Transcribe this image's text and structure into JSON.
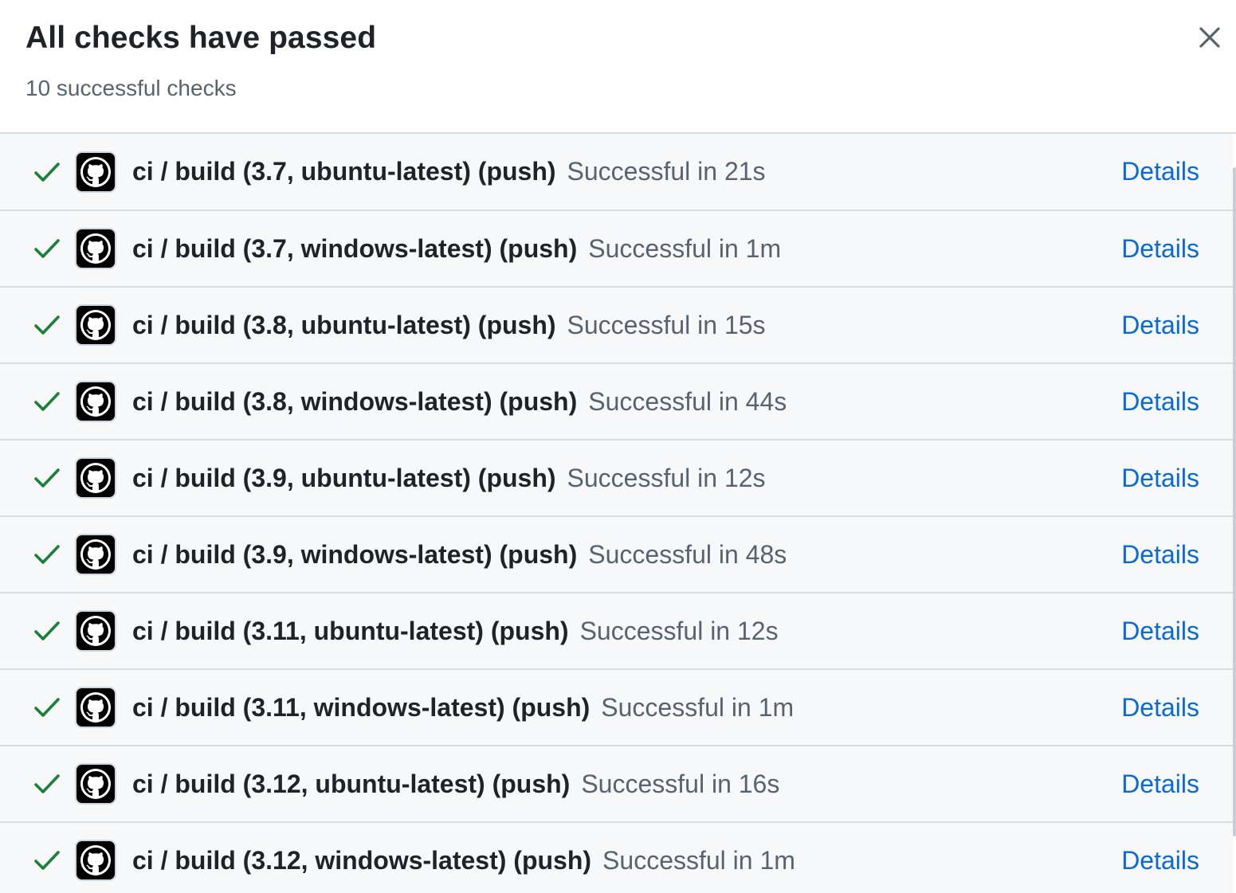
{
  "dialog": {
    "title": "All checks have passed",
    "subtitle": "10 successful checks",
    "close_icon": "close-icon"
  },
  "colors": {
    "success": "#1a7f37",
    "link": "#0969da",
    "title": "#1f2328",
    "muted": "#59636e",
    "row_bg": "#f6f8fa"
  },
  "checks": [
    {
      "name": "ci / build (3.7, ubuntu-latest) (push)",
      "status": "Successful in 21s",
      "details": "Details",
      "icon": "check-icon"
    },
    {
      "name": "ci / build (3.7, windows-latest) (push)",
      "status": "Successful in 1m",
      "details": "Details",
      "icon": "check-icon"
    },
    {
      "name": "ci / build (3.8, ubuntu-latest) (push)",
      "status": "Successful in 15s",
      "details": "Details",
      "icon": "check-icon"
    },
    {
      "name": "ci / build (3.8, windows-latest) (push)",
      "status": "Successful in 44s",
      "details": "Details",
      "icon": "check-icon"
    },
    {
      "name": "ci / build (3.9, ubuntu-latest) (push)",
      "status": "Successful in 12s",
      "details": "Details",
      "icon": "check-icon"
    },
    {
      "name": "ci / build (3.9, windows-latest) (push)",
      "status": "Successful in 48s",
      "details": "Details",
      "icon": "check-icon"
    },
    {
      "name": "ci / build (3.11, ubuntu-latest) (push)",
      "status": "Successful in 12s",
      "details": "Details",
      "icon": "check-icon"
    },
    {
      "name": "ci / build (3.11, windows-latest) (push)",
      "status": "Successful in 1m",
      "details": "Details",
      "icon": "check-icon"
    },
    {
      "name": "ci / build (3.12, ubuntu-latest) (push)",
      "status": "Successful in 16s",
      "details": "Details",
      "icon": "check-icon"
    },
    {
      "name": "ci / build (3.12, windows-latest) (push)",
      "status": "Successful in 1m",
      "details": "Details",
      "icon": "check-icon"
    }
  ]
}
